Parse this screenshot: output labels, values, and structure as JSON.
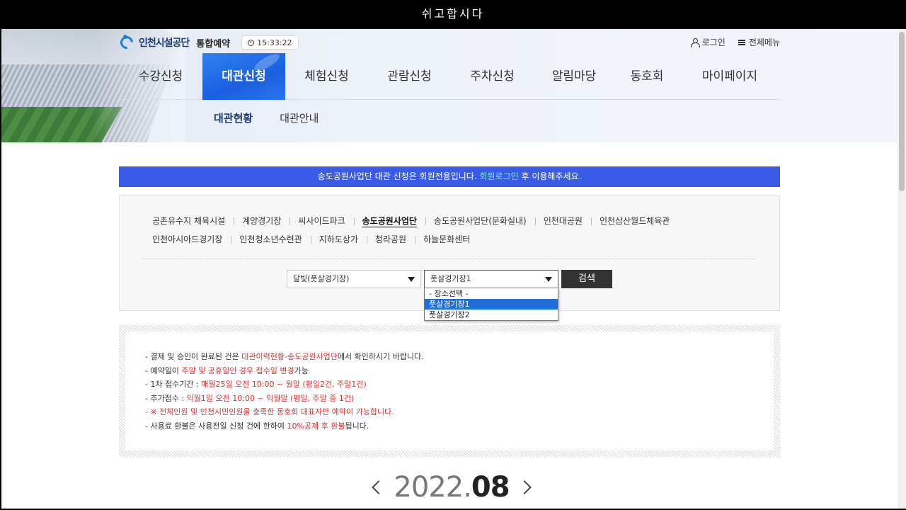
{
  "window": {
    "title": "쉬고합시다"
  },
  "header": {
    "brand": "인천시설공단",
    "service": "통합예약",
    "clock": "15:33:22",
    "util": {
      "login": "로그인",
      "all_menu": "전체메뉴"
    }
  },
  "gnb": [
    {
      "label": "수강신청",
      "active": false
    },
    {
      "label": "대관신청",
      "active": true
    },
    {
      "label": "체험신청",
      "active": false
    },
    {
      "label": "관람신청",
      "active": false
    },
    {
      "label": "주차신청",
      "active": false
    },
    {
      "label": "알림마당",
      "active": false
    },
    {
      "label": "동호회",
      "active": false
    },
    {
      "label": "마이페이지",
      "active": false
    }
  ],
  "lnb": [
    {
      "label": "대관현황",
      "active": true
    },
    {
      "label": "대관안내",
      "active": false
    }
  ],
  "notice": {
    "before": "송도공원사업단 대관 신청은 회원전용입니다. ",
    "link": "회원로그인",
    "after": " 후 이용해주세요."
  },
  "venues": {
    "row1": [
      "공촌유수지 체육시설",
      "계양경기장",
      "씨사이드파크",
      "송도공원사업단",
      "송도공원사업단(문화실내)",
      "인천대공원",
      "인천삼산월드체육관"
    ],
    "row2": [
      "인천아시아드경기장",
      "인천청소년수련관",
      "지하도상가",
      "청라공원",
      "하늘문화센터"
    ],
    "selected": "송도공원사업단"
  },
  "filters": {
    "facility": "달빛(풋살경기장)",
    "place": "풋살경기장1",
    "search_label": "검색",
    "place_options": [
      "- 장소선택 -",
      "풋살경기장1",
      "풋살경기장2"
    ]
  },
  "info": {
    "l1a": "- 결제 및 승인이 완료된 건은 ",
    "l1b": "대관이력현황-송도공원사업단",
    "l1c": "에서 확인하시기 바랍니다.",
    "l2a": "- 예약일이 ",
    "l2b": "주말 및 공휴일인 경우 접수일 변경",
    "l2c": "가능",
    "l3a": "- 1차 접수기간 : ",
    "l3b": "매월25일 오전 10:00 ~ 월말 (평일2건, 주말1건)",
    "l4a": "- 추가접수 : ",
    "l4b": "익월1일 오전 10:00 ~ 익월말 (평일, 주말 중 1건)",
    "l5": "- ※ 전체인원 및 인천시민인원을 충족한 동호회 대표자만 예약이 가능합니다.",
    "l6a": "- 사용료 환불은 사용전일 신청 건에 한하여 ",
    "l6b": "10%공제 후 환불",
    "l6c": "됩니다."
  },
  "calendar": {
    "year": "2022.",
    "month": "08"
  }
}
